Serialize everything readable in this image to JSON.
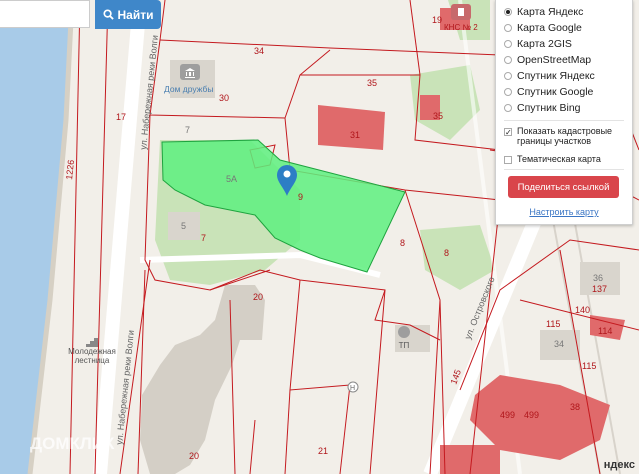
{
  "search": {
    "button_label": "Найти",
    "input_value": "",
    "input_placeholder": ""
  },
  "map": {
    "poi": {
      "dom_druzhby": "Дом дружбы",
      "kns": "КНС № 2",
      "ladder": "Молодежная лестница",
      "tp": "ТП"
    },
    "parcel_numbers": [
      "34",
      "35",
      "30",
      "17",
      "1226",
      "31",
      "35",
      "5А",
      "9",
      "5",
      "7",
      "8",
      "8",
      "20",
      "20",
      "21",
      "145",
      "36",
      "137",
      "140",
      "115",
      "114",
      "34",
      "115",
      "499",
      "499",
      "38",
      "19"
    ],
    "streets": {
      "nab_volgi_1": "ул. Набережная реки Волги",
      "nab_volgi_2": "ул. Набережная реки Волги",
      "ostrovsky": "ул. Островского"
    },
    "building_numbers": {
      "b7": "7",
      "b31": "31",
      "b35": "35",
      "b5": "5",
      "b19": "19"
    }
  },
  "layers": {
    "options": [
      {
        "label": "Карта Яндекс",
        "selected": true
      },
      {
        "label": "Карта Google",
        "selected": false
      },
      {
        "label": "Карта 2GIS",
        "selected": false
      },
      {
        "label": "OpenStreetMap",
        "selected": false
      },
      {
        "label": "Спутник Яндекс",
        "selected": false
      },
      {
        "label": "Спутник Google",
        "selected": false
      },
      {
        "label": "Спутник Bing",
        "selected": false
      }
    ],
    "cadastral": {
      "label": "Показать кадастровые границы участков",
      "checked": true
    },
    "thematic": {
      "label": "Тематическая карта",
      "checked": false
    },
    "share_button": "Поделиться ссылкой",
    "setup_link": "Настроить карту"
  },
  "watermark": "ДОМКЛИК",
  "brand": "ндекс",
  "colors": {
    "accent_blue": "#3f87c9",
    "share_red": "#d9454b",
    "parcel_line": "#c41a1f",
    "selected_parcel": "#5ef07f",
    "building_red": "#e06a6b",
    "water": "#a8cbe8",
    "park": "#c9e3b8"
  }
}
